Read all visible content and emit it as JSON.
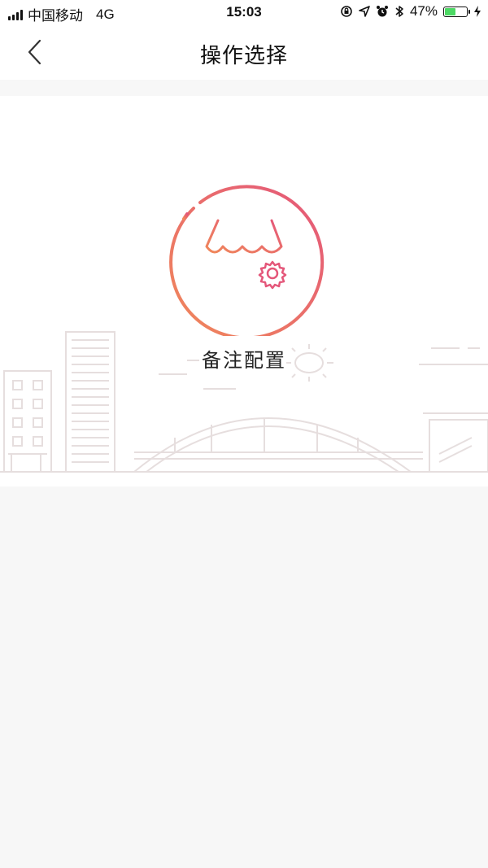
{
  "status_bar": {
    "carrier": "中国移动",
    "network": "4G",
    "time": "15:03",
    "battery_percent": "47%",
    "battery_level": 0.47,
    "icons": [
      "signal-icon",
      "rotation-lock-icon",
      "location-icon",
      "alarm-icon",
      "bluetooth-icon",
      "battery-icon",
      "charging-icon"
    ]
  },
  "nav": {
    "title": "操作选择",
    "back_icon": "chevron-left-icon"
  },
  "actions": [
    {
      "label": "备注配置",
      "icon": "store-settings-icon"
    }
  ],
  "colors": {
    "accent_start": "#e4577a",
    "accent_end": "#f0885a",
    "skyline": "#e6dede",
    "background": "#f7f7f7"
  }
}
